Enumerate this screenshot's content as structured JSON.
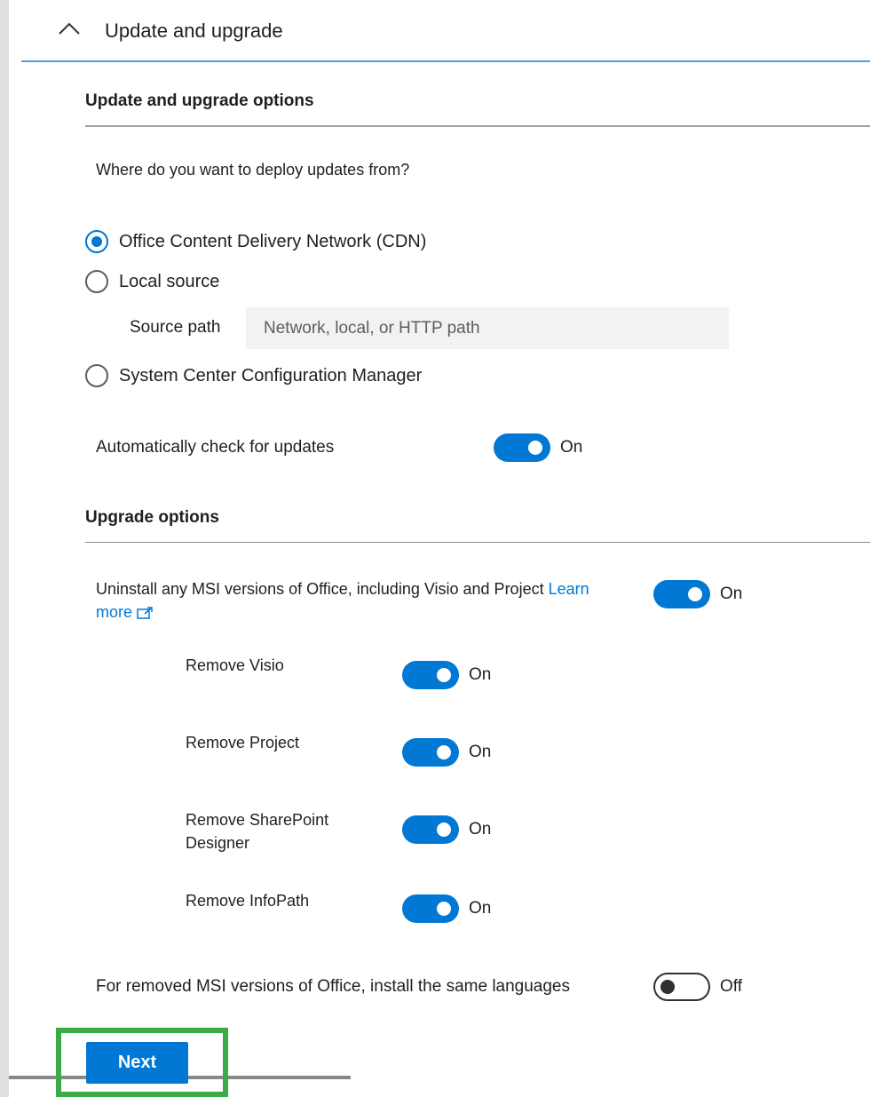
{
  "section": {
    "title": "Update and upgrade",
    "chevron_icon": "chevron-up-icon"
  },
  "update_options": {
    "heading": "Update and upgrade options",
    "question": "Where do you want to deploy updates from?",
    "radios": [
      {
        "label": "Office Content Delivery Network (CDN)",
        "checked": true
      },
      {
        "label": "Local source",
        "checked": false
      },
      {
        "label": "System Center Configuration Manager",
        "checked": false
      }
    ],
    "source_path": {
      "label": "Source path",
      "value": "",
      "placeholder": "Network, local, or HTTP path"
    },
    "auto_check": {
      "label": "Automatically check for updates",
      "state": "On"
    }
  },
  "upgrade_options": {
    "heading": "Upgrade options",
    "uninstall_msi": {
      "label": "Uninstall any MSI versions of Office, including Visio and Project",
      "link_text": "Learn more",
      "link_icon": "external-link-icon",
      "state": "On"
    },
    "remove_visio": {
      "label": "Remove Visio",
      "state": "On"
    },
    "remove_project": {
      "label": "Remove Project",
      "state": "On"
    },
    "remove_sharepoint": {
      "label_line1": "Remove SharePoint",
      "label_line2": "Designer",
      "state": "On"
    },
    "remove_infopath": {
      "label": "Remove InfoPath",
      "state": "On"
    },
    "same_languages": {
      "label": "For removed MSI versions of Office, install the same languages",
      "state": "Off"
    }
  },
  "footer": {
    "next_label": "Next"
  },
  "colors": {
    "accent": "#0078d4",
    "highlight": "#3aab47"
  }
}
